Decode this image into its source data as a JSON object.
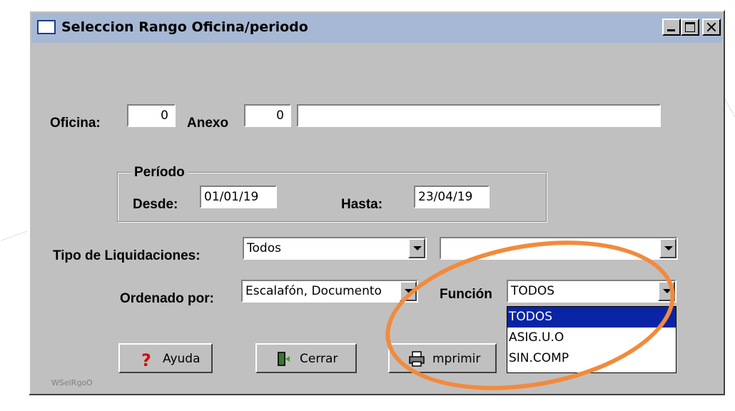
{
  "window": {
    "title": "Seleccion Rango Oficina/periodo",
    "footer_code": "WSelRgoO"
  },
  "oficina": {
    "label": "Oficina:",
    "value": "0"
  },
  "anexo": {
    "label": "Anexo",
    "value": "0",
    "description": ""
  },
  "periodo": {
    "group_label": "Período",
    "desde_label": "Desde:",
    "desde_value": "01/01/19",
    "hasta_label": "Hasta:",
    "hasta_value": "23/04/19"
  },
  "tipo_liquidaciones": {
    "label": "Tipo de Liquidaciones:",
    "selected": "Todos",
    "secondary_selected": ""
  },
  "ordenado_por": {
    "label": "Ordenado por:",
    "selected": "Escalafón, Documento"
  },
  "funcion": {
    "label": "Función",
    "selected": "TODOS",
    "options": [
      "TODOS",
      "ASIG.U.O",
      "SIN.COMP"
    ]
  },
  "buttons": {
    "ayuda": "Ayuda",
    "cerrar": "Cerrar",
    "imprimir": "mprimir"
  },
  "colors": {
    "titlebar": "#a6b8d3",
    "window_bg": "#c0c0c0",
    "selection": "#0a24a6",
    "annotation_ellipse": "#f28a3c"
  }
}
